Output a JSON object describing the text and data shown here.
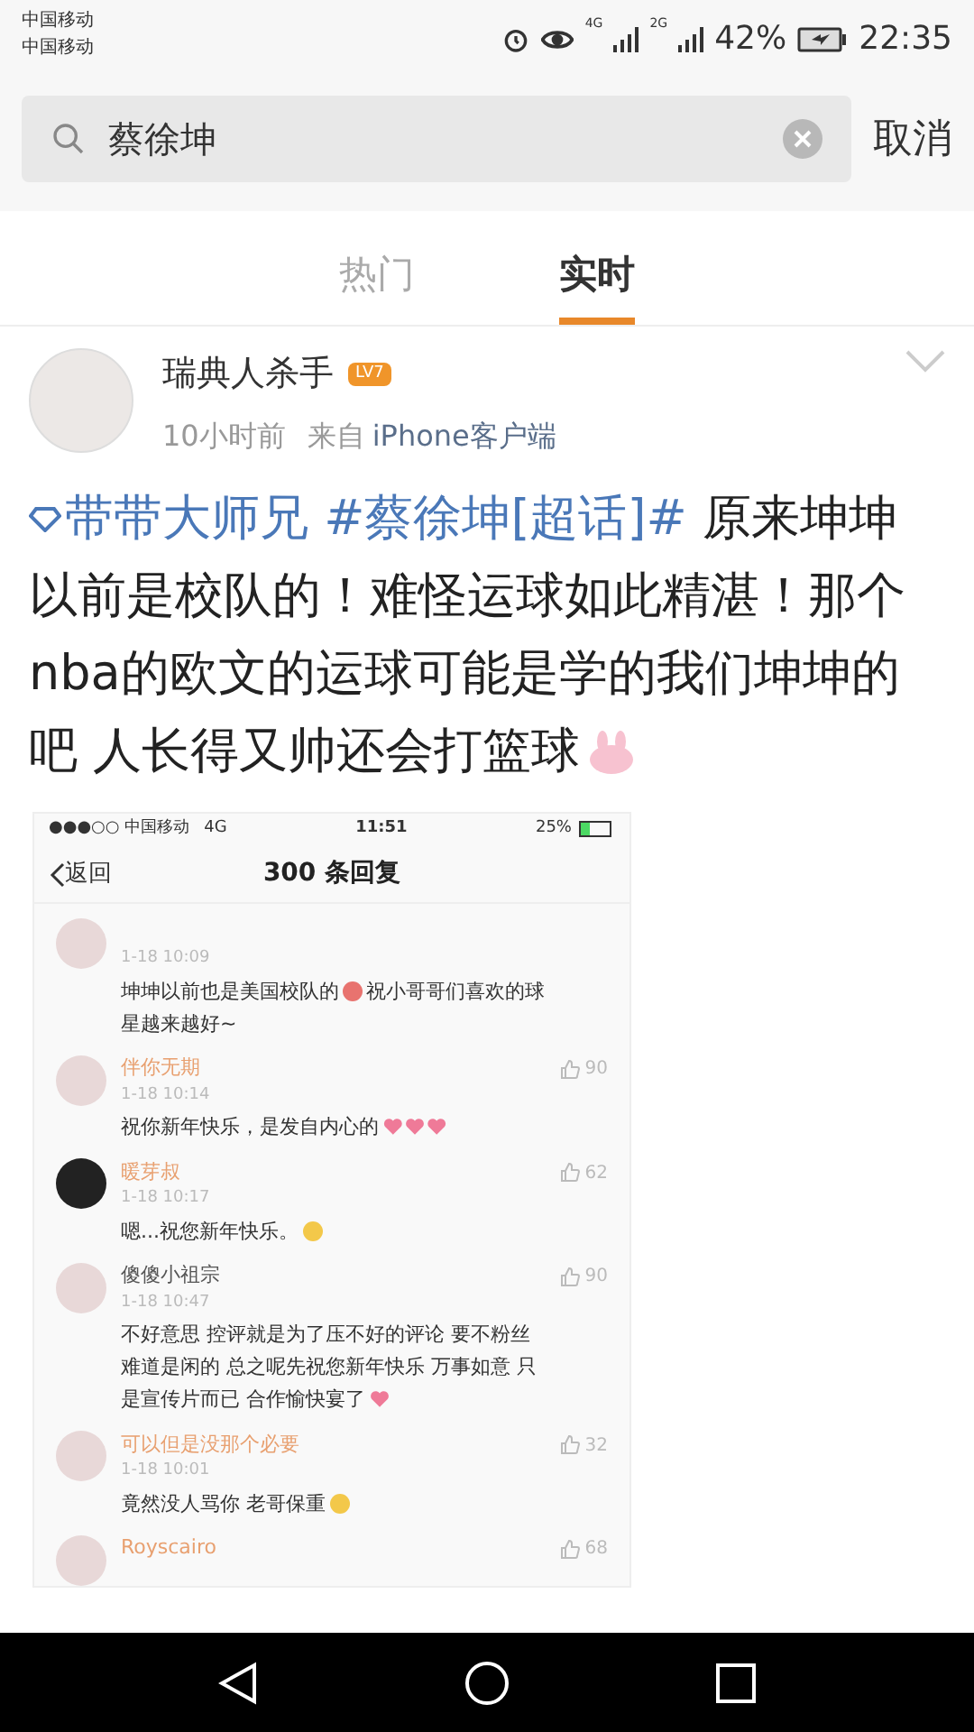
{
  "status_bar": {
    "carriers": [
      "中国移动",
      "中国移动"
    ],
    "network_1": "4G",
    "network_2": "2G",
    "battery": "42%",
    "time": "22:35"
  },
  "search": {
    "value": "蔡徐坤",
    "cancel": "取消"
  },
  "tabs": [
    {
      "label": "热门",
      "selected": false
    },
    {
      "label": "实时",
      "selected": true
    }
  ],
  "post": {
    "author": "瑞典人杀手",
    "level_badge": "LV7",
    "time": "10小时前",
    "source_prefix": "来自",
    "source": "iPhone客户端",
    "topic_link": "带带大师兄 #蔡徐坤[超话]#",
    "text": " 原来坤坤以前是校队的！难怪运球如此精湛！那个nba的欧文的运球可能是学的我们坤坤的吧 人长得又帅还会打篮球",
    "screenshot": {
      "status_bar": {
        "carrier": "●●●○○ 中国移动",
        "network": "4G",
        "time": "11:51",
        "battery": "25%"
      },
      "back": "返回",
      "title": "300 条回复",
      "comments": [
        {
          "time": "1-18 10:09",
          "text": "坤坤以前也是美国校队的",
          "text_2": "祝小哥哥们喜欢的球星越来越好~"
        },
        {
          "name": "伴你无期",
          "time": "1-18 10:14",
          "likes": "90",
          "text": "祝你新年快乐，是发自内心的"
        },
        {
          "name": "暖芽叔",
          "time": "1-18 10:17",
          "likes": "62",
          "text": "嗯...祝您新年快乐。"
        },
        {
          "name": "傻傻小祖宗",
          "time": "1-18 10:47",
          "likes": "90",
          "text": "不好意思 控评就是为了压不好的评论 要不粉丝难道是闲的 总之呢先祝您新年快乐 万事如意 只是宣传片而已 合作愉快宴了"
        },
        {
          "name": "可以但是没那个必要",
          "time": "1-18 10:01",
          "likes": "32",
          "text": "竟然没人骂你 老哥保重"
        },
        {
          "name": "Royscairo",
          "likes": "68"
        }
      ]
    }
  }
}
